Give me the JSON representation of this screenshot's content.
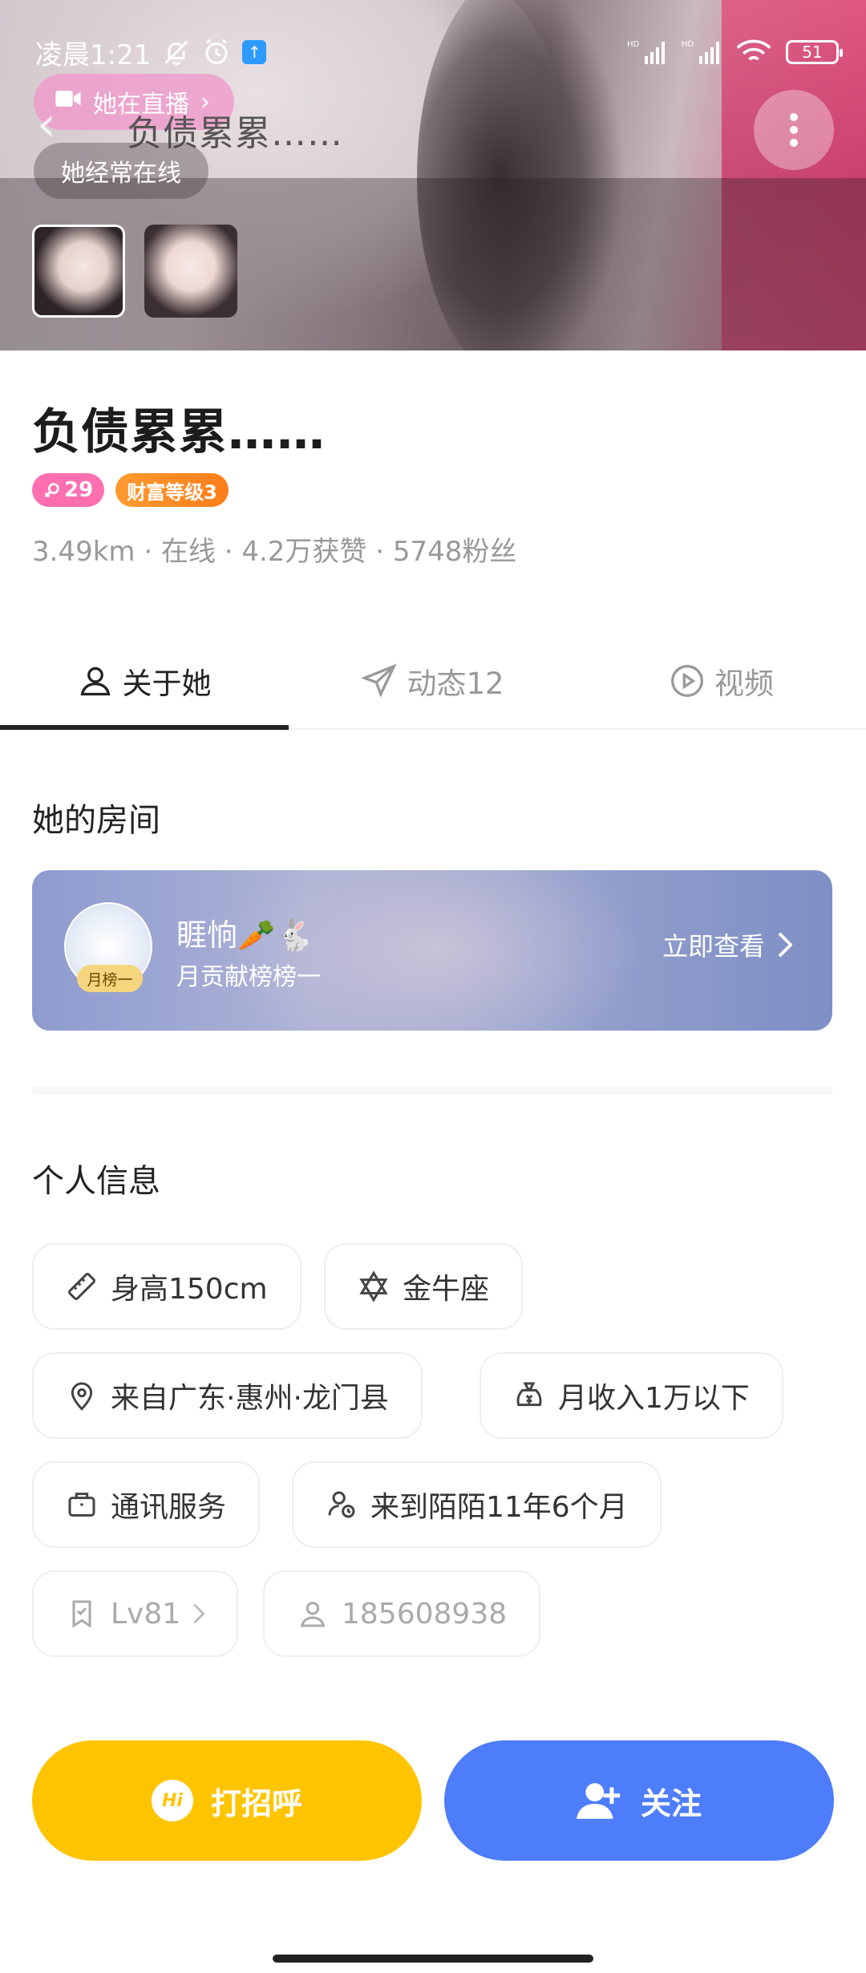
{
  "status_bar": {
    "time": "凌晨1:21",
    "battery": "51",
    "signal_labels": [
      "HD",
      "HD"
    ]
  },
  "hero": {
    "live_label": "她在直播",
    "live_chevron": "›",
    "title": "负债累累……",
    "online_label": "她经常在线"
  },
  "profile": {
    "name": "负债累累……",
    "age": "29",
    "wealth_badge": "财富等级3",
    "meta": "3.49km · 在线 · 4.2万获赞 · 5748粉丝"
  },
  "tabs": [
    {
      "label": "关于她",
      "icon": "person-icon",
      "active": true
    },
    {
      "label": "动态12",
      "icon": "send-icon",
      "active": false
    },
    {
      "label": "视频",
      "icon": "play-icon",
      "active": false
    }
  ],
  "room": {
    "section_title": "她的房间",
    "name": "睚恦🥕🐇",
    "subtitle": "月贡献榜榜一",
    "rank_tag": "月榜一",
    "action": "立即查看"
  },
  "info": {
    "section_title": "个人信息",
    "height": "身高150cm",
    "zodiac": "金牛座",
    "location": "来自广东·惠州·龙门县",
    "income": "月收入1万以下",
    "job": "通讯服务",
    "joined": "来到陌陌11年6个月",
    "level": "Lv81",
    "user_id": "185608938"
  },
  "actions": {
    "greet": "打招呼",
    "greet_icon_text": "Hi",
    "follow": "关注"
  },
  "colors": {
    "greet": "#ffc400",
    "follow": "#4d7dfa",
    "age_badge": "#ff6fb0",
    "wealth_badge": "#ff8a24"
  }
}
